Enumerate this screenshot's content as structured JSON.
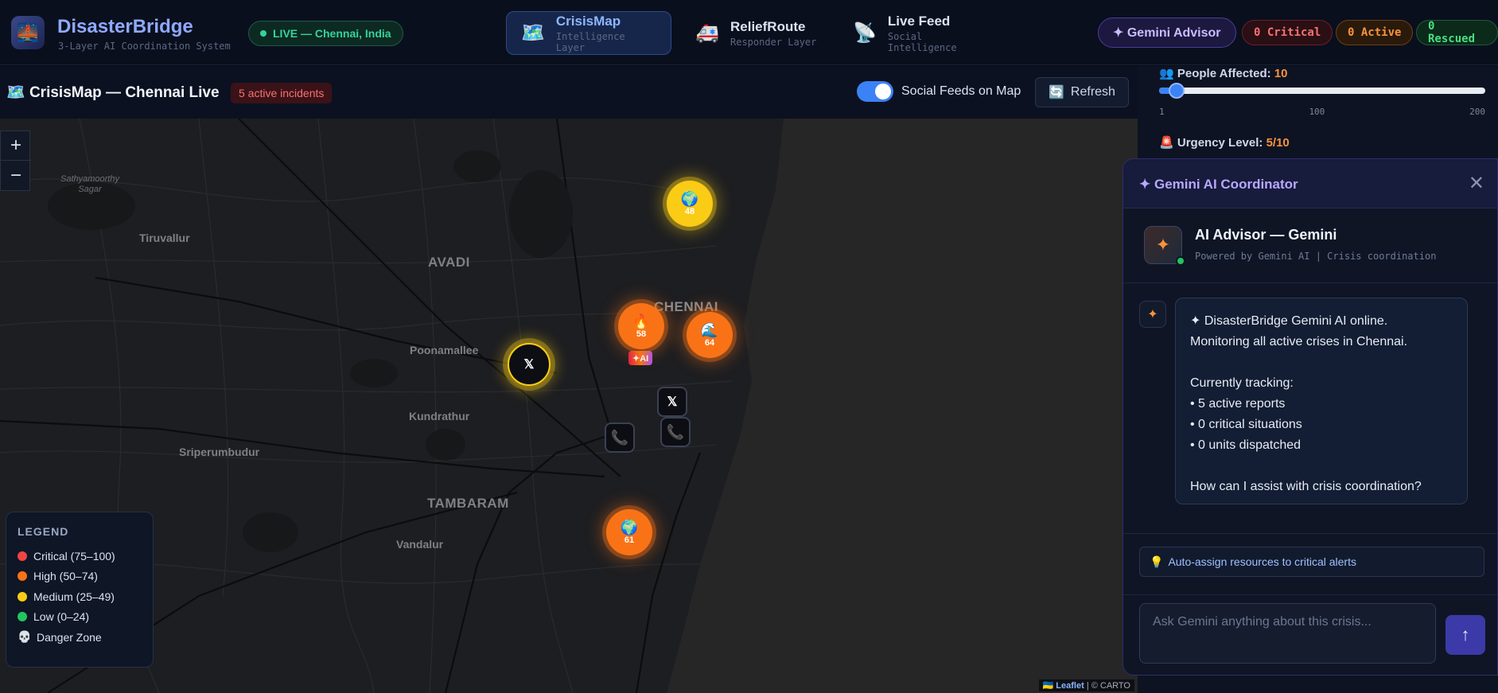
{
  "header": {
    "app_name": "DisasterBridge",
    "app_subtitle": "3-Layer AI Coordination System",
    "live_status": "LIVE — Chennai, India",
    "tabs": [
      {
        "title": "CrisisMap",
        "subtitle": "Intelligence Layer",
        "icon": "map-icon"
      },
      {
        "title": "ReliefRoute",
        "subtitle": "Responder Layer",
        "icon": "ambulance-icon"
      },
      {
        "title": "Live Feed",
        "subtitle": "Social Intelligence",
        "icon": "satellite-icon"
      }
    ],
    "gemini_button": "✦ Gemini Advisor",
    "stats": {
      "critical": "0 Critical",
      "active": "0 Active",
      "rescued": "0 Rescued"
    }
  },
  "map_bar": {
    "title": "CrisisMap — Chennai Live",
    "incidents": "5 active incidents",
    "toggle_label": "Social Feeds on Map",
    "toggle_on": true,
    "refresh_label": "Refresh"
  },
  "map": {
    "zoom_in": "+",
    "zoom_out": "−",
    "places": {
      "sathyamoorthy": "Sathyamoorthy Sagar",
      "tiruvallur": "Tiruvallur",
      "avadi": "AVADI",
      "chennai": "CHENNAI",
      "poonamallee": "Poonamallee",
      "kundrathur": "Kundrathur",
      "sriperumbudur": "Sriperumbudur",
      "tambaram": "TAMBARAM",
      "vandalur": "Vandalur"
    },
    "markers": [
      {
        "score": "48",
        "emoji": "🌍",
        "level": "medium"
      },
      {
        "score": "58",
        "emoji": "🔥",
        "level": "high"
      },
      {
        "score": "64",
        "emoji": "🌊",
        "level": "high"
      },
      {
        "score": "61",
        "emoji": "🌍",
        "level": "high"
      }
    ],
    "ai_tag": "✦AI",
    "legend": {
      "title": "LEGEND",
      "items": [
        {
          "label": "Critical (75–100)",
          "color": "#ef4444"
        },
        {
          "label": "High (50–74)",
          "color": "#f97316"
        },
        {
          "label": "Medium (25–49)",
          "color": "#facc15"
        },
        {
          "label": "Low (0–24)",
          "color": "#22c55e"
        },
        {
          "label": "Danger Zone",
          "icon": "skull-icon"
        }
      ]
    },
    "attribution_leaflet": "Leaflet",
    "attribution_carto": "| © CARTO"
  },
  "side_panel": {
    "people_label": "People Affected:",
    "people_value": "10",
    "slider_min": "1",
    "slider_mid": "100",
    "slider_max": "200",
    "urgency_label": "Urgency Level:",
    "urgency_value": "5/10"
  },
  "gemini": {
    "header_title": "✦ Gemini AI Coordinator",
    "name": "AI Advisor — Gemini",
    "powered": "Powered by Gemini AI | Crisis coordination",
    "message_lines": [
      "✦ DisasterBridge Gemini AI online.",
      "Monitoring all active crises in Chennai.",
      "",
      "Currently tracking:",
      "• 5 active reports",
      "• 0 critical situations",
      "• 0 units dispatched",
      "",
      "How can I assist with crisis coordination?"
    ],
    "suggestion": "Auto-assign resources to critical alerts",
    "input_placeholder": "Ask Gemini anything about this crisis...",
    "send_label": "↑"
  }
}
